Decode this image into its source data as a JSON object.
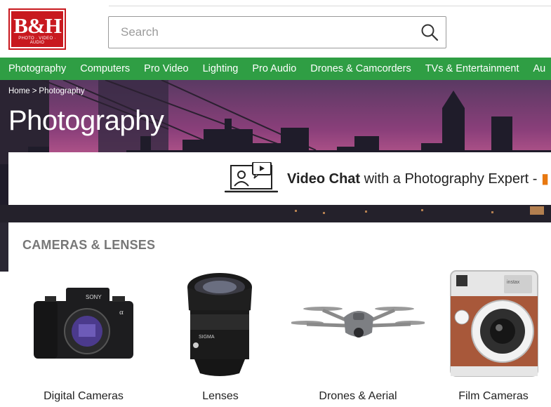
{
  "brand": {
    "logo_text": "B&H",
    "logo_subtext": "PHOTO · VIDEO · AUDIO",
    "color": "#c8191f"
  },
  "search": {
    "placeholder": "Search"
  },
  "nav": {
    "color": "#2f9e44",
    "items": [
      "Photography",
      "Computers",
      "Pro Video",
      "Lighting",
      "Pro Audio",
      "Drones & Camcorders",
      "TVs & Entertainment",
      "Au"
    ]
  },
  "breadcrumb": {
    "home": "Home",
    "separator": ">",
    "current": "Photography"
  },
  "hero": {
    "title": "Photography"
  },
  "chat_banner": {
    "bold": "Video Chat",
    "rest": " with a Photography Expert - ",
    "accent_color": "#e8780f"
  },
  "section": {
    "title": "CAMERAS & LENSES",
    "tiles": [
      {
        "label": "Digital Cameras",
        "icon": "mirrorless-camera-icon"
      },
      {
        "label": "Lenses",
        "icon": "camera-lens-icon"
      },
      {
        "label": "Drones & Aerial",
        "icon": "drone-icon"
      },
      {
        "label": "Film Cameras",
        "icon": "instant-camera-icon"
      }
    ]
  }
}
